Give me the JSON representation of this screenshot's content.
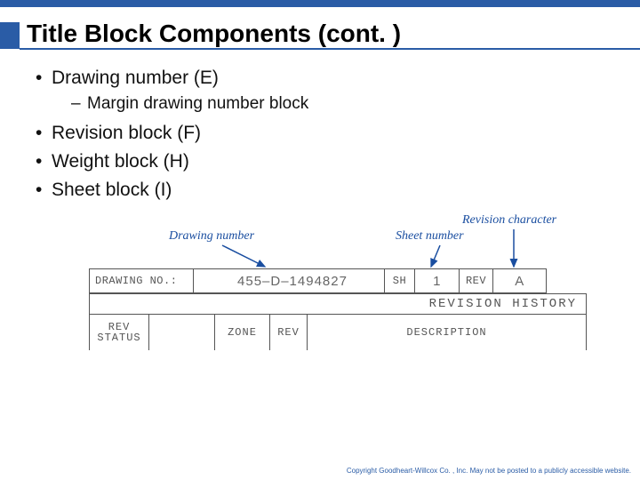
{
  "title": "Title Block Components (cont. )",
  "bullets": {
    "b1": "Drawing number (E)",
    "b1_sub": "Margin drawing number block",
    "b2": "Revision block (F)",
    "b3": "Weight block (H)",
    "b4": "Sheet block (I)"
  },
  "callouts": {
    "drawing_number": "Drawing number",
    "sheet_number": "Sheet number",
    "revision_character": "Revision character"
  },
  "row1": {
    "drawing_no_label": "DRAWING  NO.:",
    "drawing_no_value": "455–D–1494827",
    "sh_label": "SH",
    "sh_value": "1",
    "rev_label": "REV",
    "rev_value": "A"
  },
  "revhist": {
    "header": "REVISION  HISTORY",
    "col_rev_line1": "REV",
    "col_rev_line2": "STATUS",
    "col_zone": "ZONE",
    "col_rev2": "REV",
    "col_desc": "DESCRIPTION"
  },
  "footer": "Copyright Goodheart-Willcox Co. , Inc.  May not be posted to a publicly accessible website."
}
